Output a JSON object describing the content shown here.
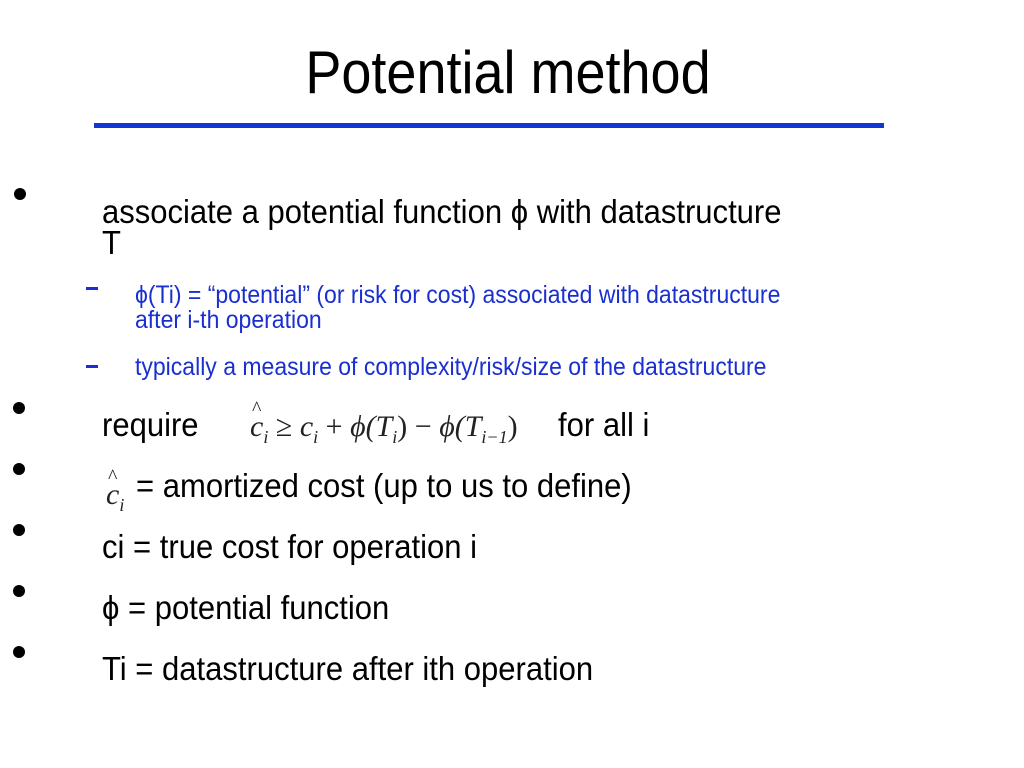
{
  "slide": {
    "title": "Potential method",
    "accent_color": "#1036d8",
    "bullets": [
      {
        "text": "associate a potential function ϕ with datastructure",
        "wrap": "T",
        "sub_items": [
          {
            "text": "ϕ(Ti) = “potential” (or risk for cost) associated with datastructure",
            "wrap": "after i-th operation"
          },
          {
            "text": "typically a measure of complexity/risk/size of the datastructure"
          }
        ]
      },
      {
        "text_before": "require",
        "formula": {
          "lhs": "c",
          "lhs_sub": "i",
          "op": "≥",
          "c": "c",
          "c_sub": "i",
          "plus": "+",
          "phi1": "ϕ(T",
          "phi1_sub": "i",
          "close1": ")",
          "minus": "−",
          "phi2": "ϕ(T",
          "phi2_sub": "i−1",
          "close2": ")"
        },
        "text_after": "for all i"
      },
      {
        "symbol": "c",
        "symbol_sub": "i",
        "text": "= amortized cost (up to us to define)"
      },
      {
        "text": "ci = true cost for operation i"
      },
      {
        "text": "ϕ = potential function"
      },
      {
        "text": "Ti = datastructure after ith operation"
      }
    ]
  }
}
